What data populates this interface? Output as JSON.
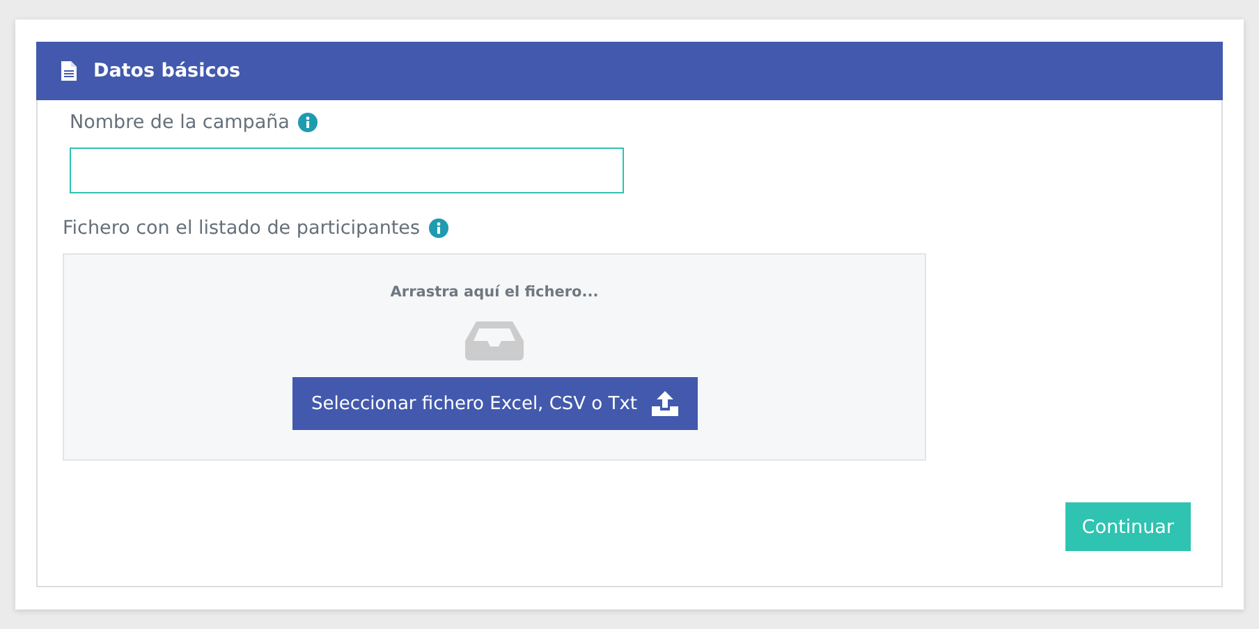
{
  "panel": {
    "title": "Datos básicos"
  },
  "fields": [
    {
      "label": "Nombre de la campaña",
      "kind": "text"
    },
    {
      "label": "Fichero con el listado de participantes",
      "kind": "file",
      "dropzone": {
        "hint": "Arrastra aquí el fichero...",
        "button": "Seleccionar fichero Excel, CSV o Txt"
      }
    }
  ],
  "submit": "Continuar"
}
